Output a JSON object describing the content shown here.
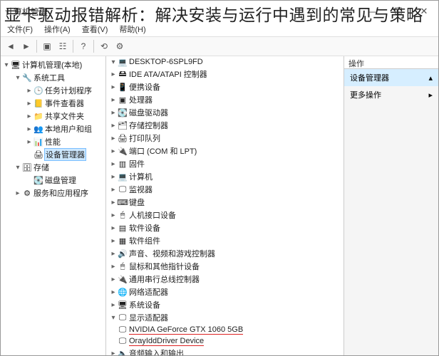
{
  "overlay_title": "显卡驱动报错解析：解决安装与运行中遇到的常见与策略",
  "window": {
    "title": "计算机管理"
  },
  "menubar": {
    "items": [
      "文件(F)",
      "操作(A)",
      "查看(V)",
      "帮助(H)"
    ]
  },
  "left": {
    "root": "计算机管理(本地)",
    "sys_tools": "系统工具",
    "task": "任务计划程序",
    "event": "事件查看器",
    "shared": "共享文件夹",
    "users": "本地用户和组",
    "perf": "性能",
    "devmgr": "设备管理器",
    "storage": "存储",
    "disk": "磁盘管理",
    "svc": "服务和应用程序"
  },
  "mid": {
    "root": "DESKTOP-6SPL9FD",
    "items": [
      "IDE ATA/ATAPI 控制器",
      "便携设备",
      "处理器",
      "磁盘驱动器",
      "存储控制器",
      "打印队列",
      "端口 (COM 和 LPT)",
      "固件",
      "计算机",
      "监视器",
      "键盘",
      "人机接口设备",
      "软件设备",
      "软件组件",
      "声音、视频和游戏控制器",
      "鼠标和其他指针设备",
      "通用串行总线控制器",
      "网络适配器",
      "系统设备",
      "显示适配器",
      "音频输入和输出"
    ],
    "gpu1": "NVIDIA GeForce GTX 1060 5GB",
    "gpu2": "OrayIddDriver Device"
  },
  "right": {
    "hdr": "操作",
    "devmgr": "设备管理器",
    "more": "更多操作"
  }
}
